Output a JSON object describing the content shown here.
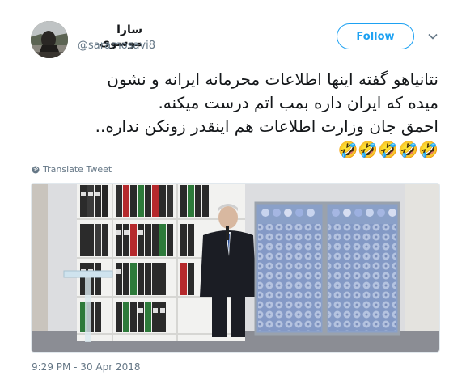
{
  "user": {
    "display_name": "سارا موسوی",
    "handle": "@saramosavi8"
  },
  "follow_label": "Follow",
  "tweet": {
    "lines": [
      "نتانیاهو گفته اینها اطلاعات محرمانه ایرانه و نشون",
      "میده که ایران داره بمب اتم درست میکنه.",
      "احمق جان وزارت اطلاعات هم اینقدر زونکن نداره..",
      "🤣🤣🤣🤣🤣"
    ]
  },
  "translate_label": "Translate Tweet",
  "timestamp": "9:29 PM - 30 Apr 2018",
  "colors": {
    "accent": "#1da1f2",
    "secondary_text": "#657786"
  },
  "icons": {
    "chevron": "chevron-down-icon",
    "translate": "globe-icon"
  }
}
